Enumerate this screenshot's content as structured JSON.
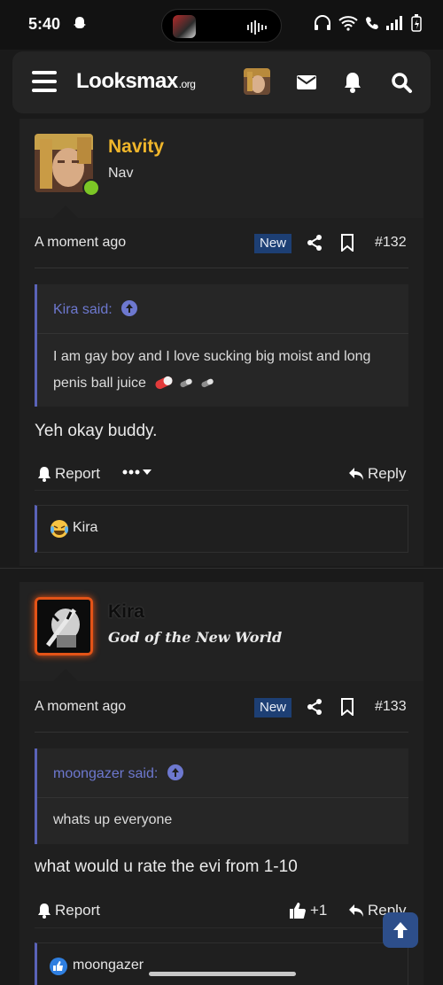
{
  "status_bar": {
    "time": "5:40"
  },
  "header": {
    "brand": "Looksmax",
    "brand_suffix": ".org"
  },
  "posts": [
    {
      "username": "Navity",
      "username_color": "#f0b62b",
      "user_title": "Nav",
      "time": "A moment ago",
      "badge": "New",
      "number": "#132",
      "quote_author": "Kira said:",
      "quote_text": "I am gay boy and I love sucking big moist and long penis ball juice",
      "message": "Yeh okay buddy.",
      "report_label": "Report",
      "reply_label": "Reply",
      "reaction_user": "Kira",
      "online": true
    },
    {
      "username": "Kira",
      "user_title": "God of the New World",
      "time": "A moment ago",
      "badge": "New",
      "number": "#133",
      "quote_author": "moongazer said:",
      "quote_text": "whats up everyone",
      "message": "what would u rate the evi from 1-10",
      "report_label": "Report",
      "like_count": "+1",
      "reply_label": "Reply",
      "reaction_user": "moongazer"
    }
  ],
  "icons": {
    "menu": "hamburger-icon",
    "mail": "mail-icon",
    "bell": "bell-icon",
    "search": "search-icon",
    "share": "share-icon",
    "bookmark": "bookmark-icon",
    "reply": "reply-icon",
    "like": "thumbs-up-icon",
    "scroll_top": "arrow-up-icon"
  },
  "colors": {
    "accent": "#5a63b8",
    "new_badge": "#1d3f74",
    "online": "#7cc626"
  }
}
